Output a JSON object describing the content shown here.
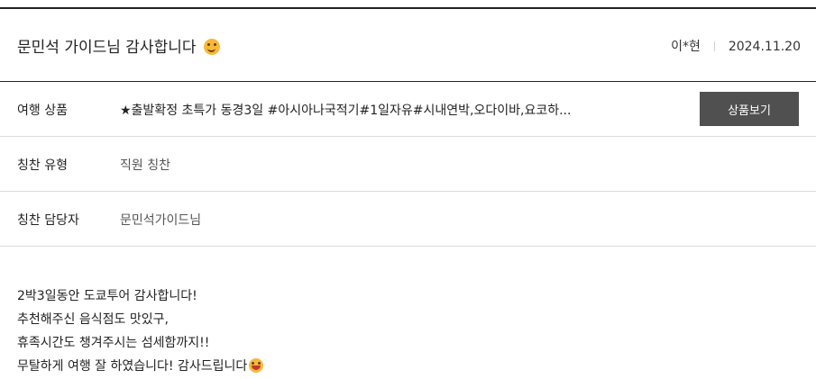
{
  "review": {
    "title": "문민석 가이드님 감사합니다",
    "title_emoji_icon": "smiling-face-icon",
    "author": "이*현",
    "date": "2024.11.20"
  },
  "details": {
    "product": {
      "label": "여행 상품",
      "value": "★출발확정 초특가 동경3일 #아시아나국적기#1일자유#시내연박,오다이바,요코하...",
      "button_label": "상품보기"
    },
    "praise_type": {
      "label": "칭찬 유형",
      "value": "직원 칭찬"
    },
    "praise_target": {
      "label": "칭찬 담당자",
      "value": "문민석가이드님"
    }
  },
  "body": {
    "lines": [
      "2박3일동안 도쿄투어 감사합니다!",
      "추천해주신 음식점도 맛있구,",
      "휴족시간도 챙겨주시는 섬세함까지!!",
      "무탈하게 여행 잘 하였습니다! 감사드립니다"
    ],
    "end_emoji_icon": "grinning-face-icon"
  },
  "colors": {
    "rule": "#222222",
    "divider": "#dcdcdc",
    "button_bg": "#505050",
    "button_text": "#ffffff"
  }
}
